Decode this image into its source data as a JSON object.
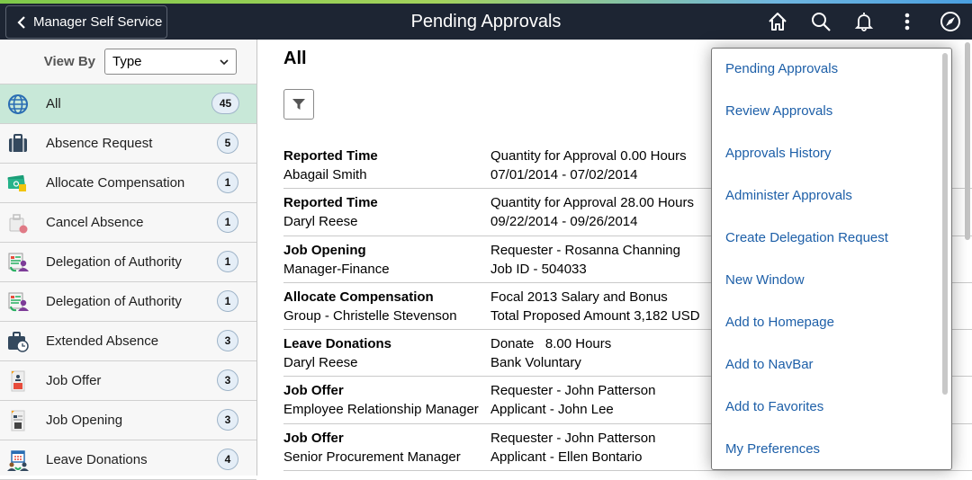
{
  "header": {
    "back_label": "Manager Self Service",
    "title": "Pending Approvals",
    "icons": [
      "home-icon",
      "search-icon",
      "notifications-bell-icon",
      "actions-menu-icon",
      "navbar-compass-icon"
    ]
  },
  "sidebar": {
    "view_by_label": "View By",
    "view_by_value": "Type",
    "items": [
      {
        "label": "All",
        "count": "45",
        "icon": "globe-icon",
        "active": true
      },
      {
        "label": "Absence Request",
        "count": "5",
        "icon": "briefcase-icon"
      },
      {
        "label": "Allocate Compensation",
        "count": "1",
        "icon": "money-icon"
      },
      {
        "label": "Cancel Absence",
        "count": "1",
        "icon": "cancel-briefcase-icon"
      },
      {
        "label": "Delegation of Authority",
        "count": "1",
        "icon": "delegation-icon"
      },
      {
        "label": "Delegation of Authority",
        "count": "1",
        "icon": "delegation-icon"
      },
      {
        "label": "Extended Absence",
        "count": "3",
        "icon": "briefcase-clock-icon"
      },
      {
        "label": "Job Offer",
        "count": "3",
        "icon": "job-offer-icon"
      },
      {
        "label": "Job Opening",
        "count": "3",
        "icon": "job-opening-icon"
      },
      {
        "label": "Leave Donations",
        "count": "4",
        "icon": "leave-donation-icon"
      }
    ]
  },
  "main": {
    "title": "All",
    "filter_icon": "filter-icon",
    "rows": [
      {
        "type": "Reported Time",
        "subject": "Abagail Smith",
        "detail1": "Quantity for Approval 0.00 Hours",
        "detail2": "07/01/2014 - 07/02/2014"
      },
      {
        "type": "Reported Time",
        "subject": "Daryl Reese",
        "detail1": "Quantity for Approval 28.00 Hours",
        "detail2": "09/22/2014 - 09/26/2014"
      },
      {
        "type": "Job Opening",
        "subject": "Manager-Finance",
        "detail1": "Requester - Rosanna Channing",
        "detail2": "Job ID - 504033"
      },
      {
        "type": "Allocate Compensation",
        "subject": "Group - Christelle Stevenson",
        "detail1": "Focal 2013 Salary and Bonus",
        "detail2": "Total Proposed Amount 3,182 USD"
      },
      {
        "type": "Leave Donations",
        "subject": "Daryl Reese",
        "detail1": "Donate   8.00 Hours",
        "detail2": "Bank Voluntary"
      },
      {
        "type": "Job Offer",
        "subject": "Employee Relationship Manager",
        "detail1": "Requester - John Patterson",
        "detail2": "Applicant - John Lee"
      },
      {
        "type": "Job Offer",
        "subject": "Senior Procurement Manager",
        "detail1": "Requester - John Patterson",
        "detail2": "Applicant - Ellen Bontario"
      }
    ]
  },
  "actions_menu": {
    "items": [
      "Pending Approvals",
      "Review Approvals",
      "Approvals History",
      "Administer Approvals",
      "Create Delegation Request",
      "New Window",
      "Add to Homepage",
      "Add to NavBar",
      "Add to Favorites",
      "My Preferences"
    ]
  },
  "colors": {
    "header_bg": "#1d2533",
    "active_item_bg": "#c8e8d8",
    "menu_link": "#1d5fa8"
  }
}
